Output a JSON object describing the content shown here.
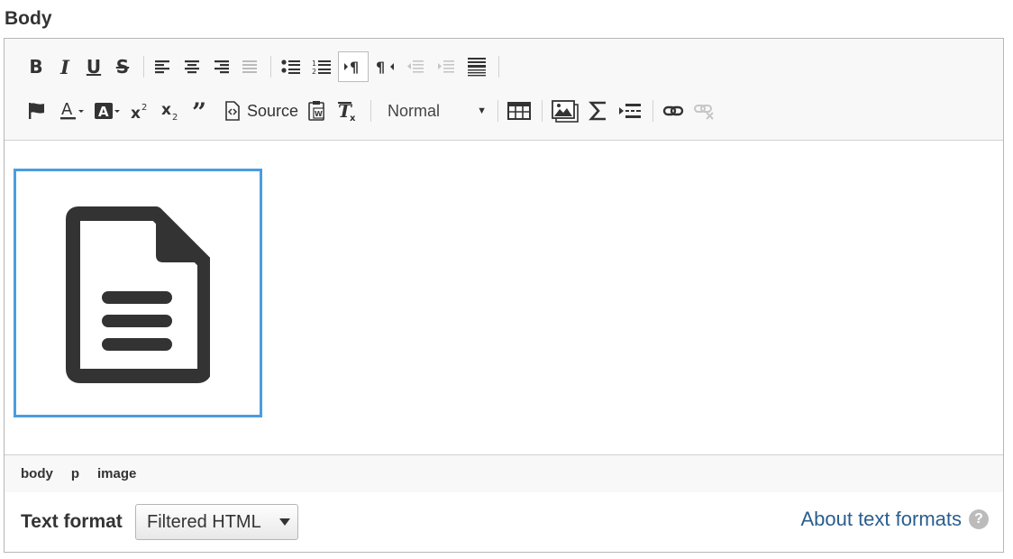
{
  "field": {
    "label": "Body"
  },
  "toolbar": {
    "source_label": "Source",
    "format_combo": {
      "value": "Normal"
    },
    "row1": [
      "bold-icon",
      "italic-icon",
      "underline-icon",
      "strikethrough-icon",
      "align-left-icon",
      "align-center-icon",
      "align-right-icon",
      "justify-icon",
      "bulleted-list-icon",
      "numbered-list-icon",
      "ltr-icon",
      "rtl-icon",
      "outdent-icon",
      "indent-icon",
      "horizontal-rule-icon"
    ],
    "row2": [
      "flag-icon",
      "text-color-icon",
      "background-color-icon",
      "superscript-icon",
      "subscript-icon",
      "blockquote-icon",
      "source-icon",
      "paste-from-word-icon",
      "remove-format-icon",
      "table-icon",
      "image-icon",
      "math-icon",
      "page-break-icon",
      "link-icon",
      "unlink-icon"
    ]
  },
  "content": {
    "widget_icon": "document-icon"
  },
  "statusbar": {
    "path": [
      "body",
      "p",
      "image"
    ]
  },
  "text_format": {
    "label": "Text format",
    "selected": "Filtered HTML",
    "about_link": "About text formats",
    "help_glyph": "?"
  },
  "colors": {
    "accent": "#4a9de0",
    "link": "#2a5e8f",
    "toolbar_bg": "#f8f8f8"
  }
}
